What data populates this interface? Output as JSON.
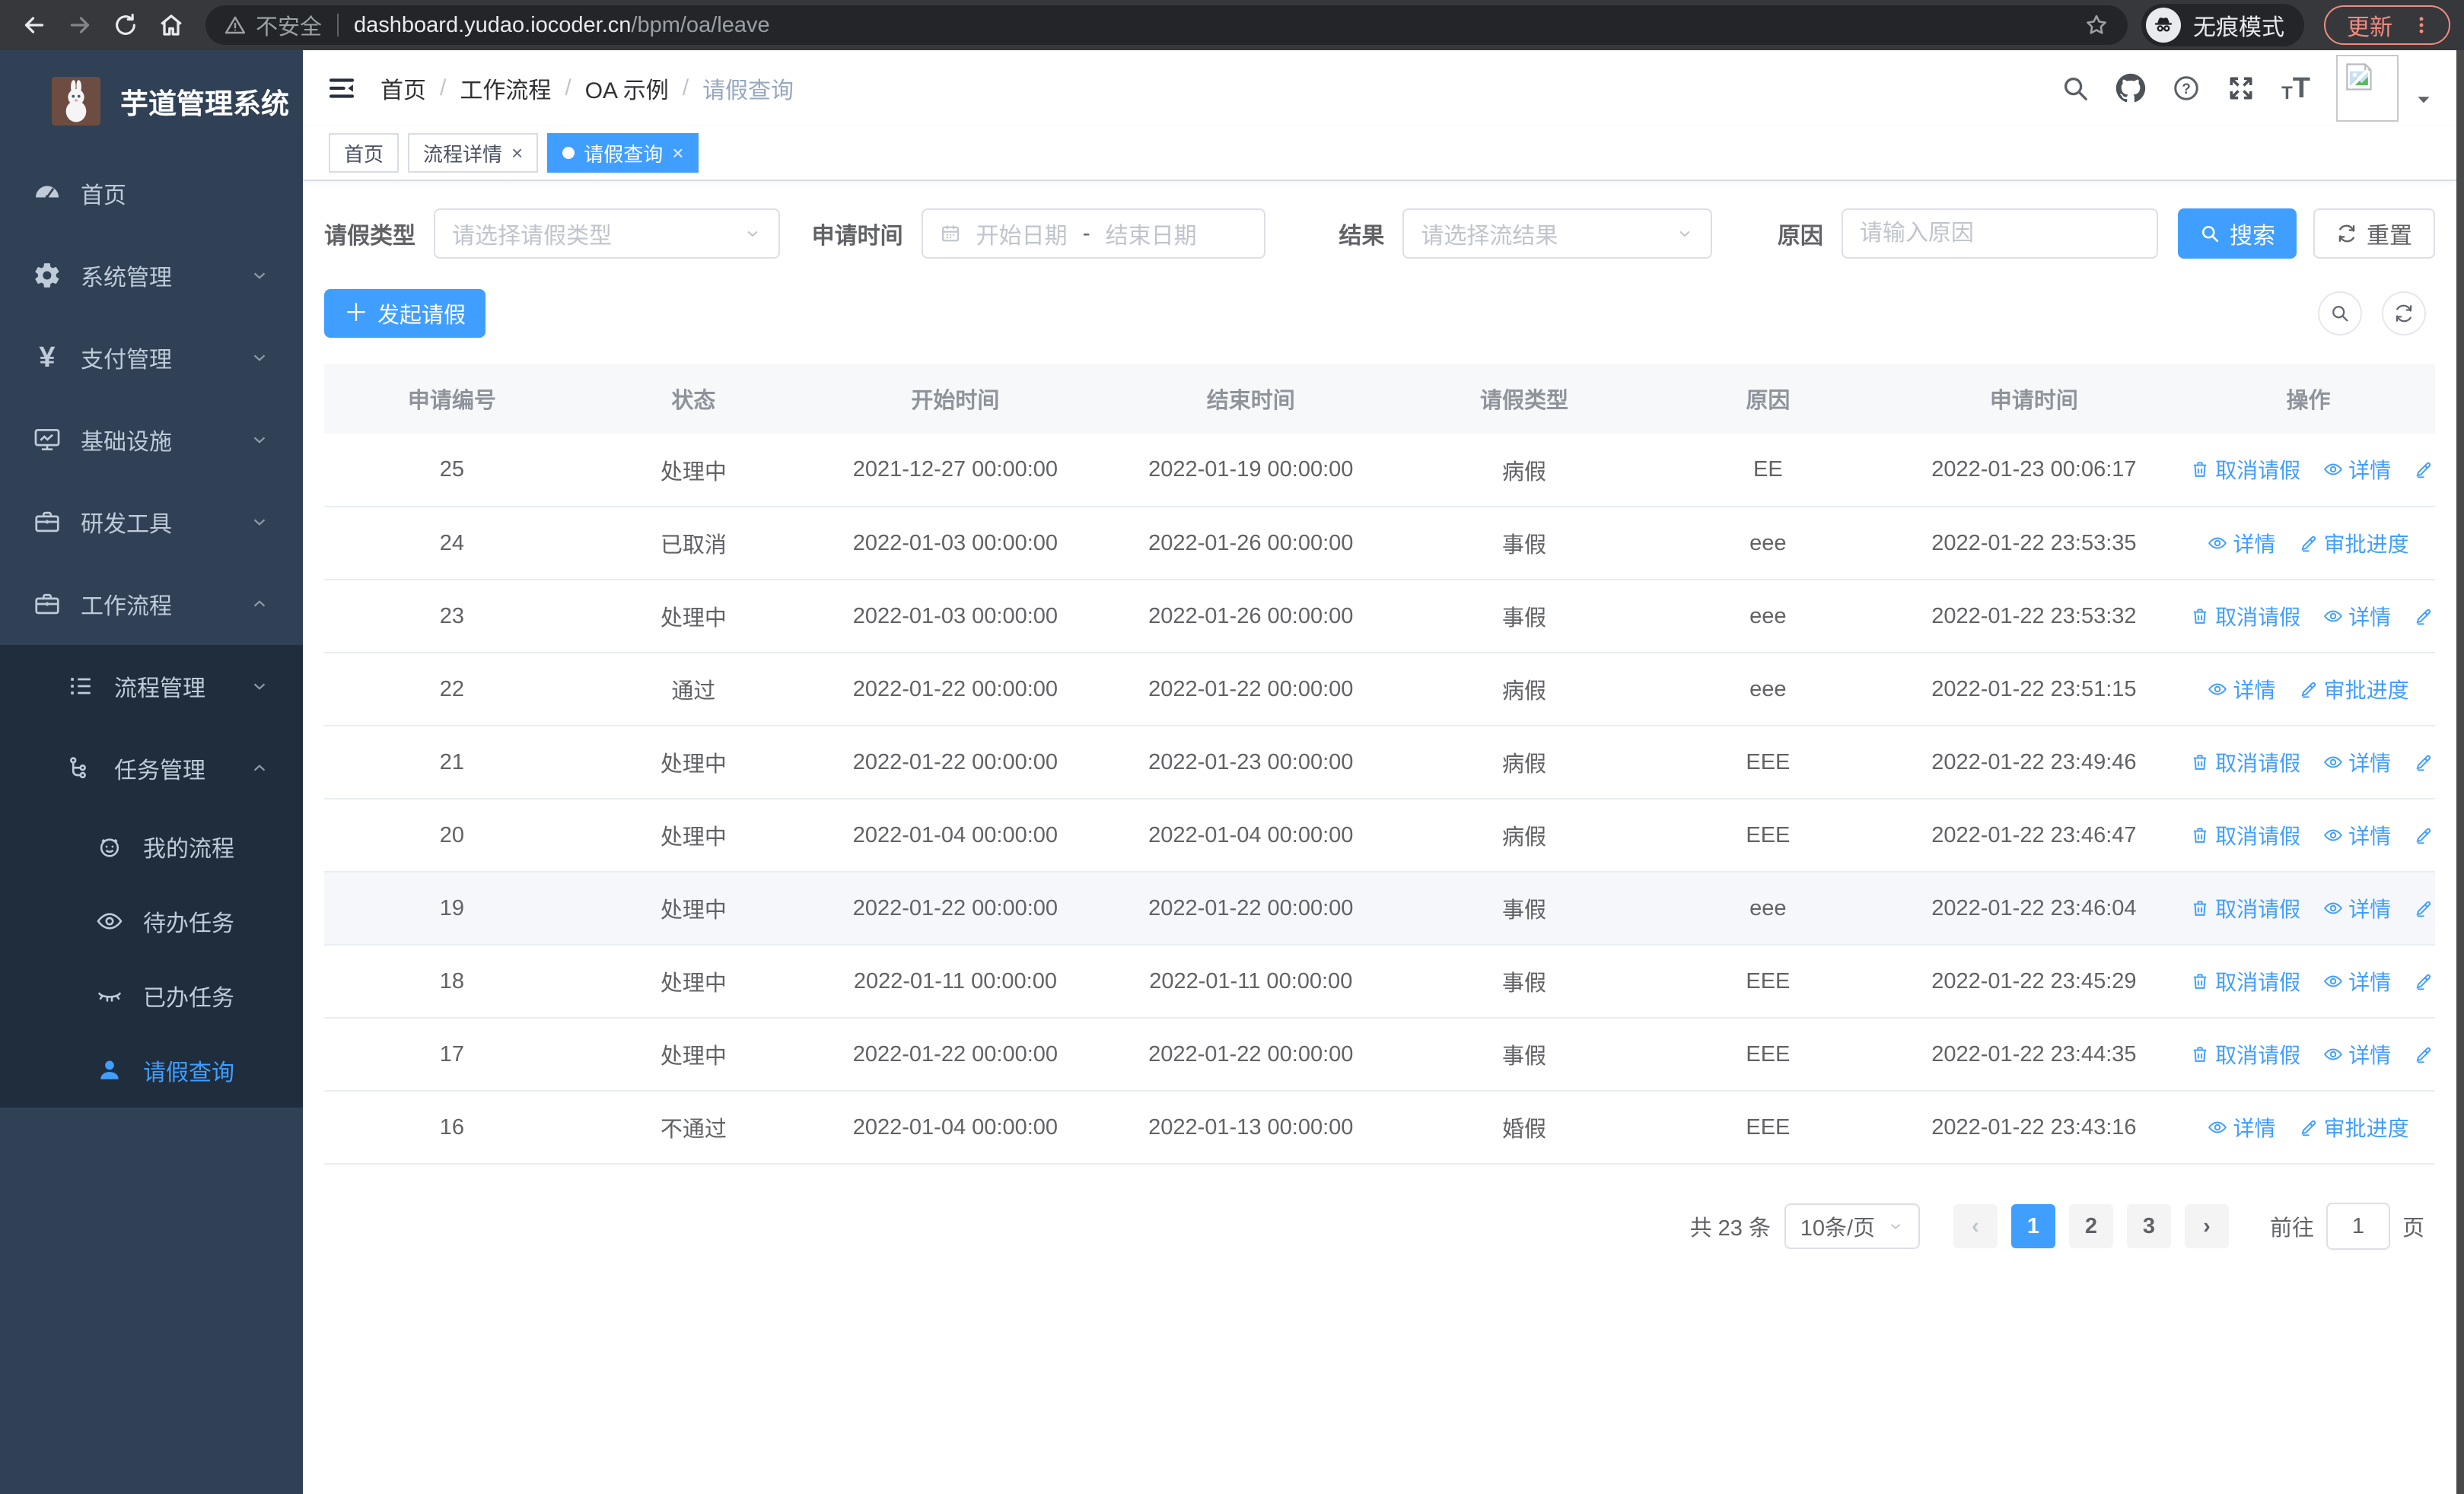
{
  "browser": {
    "security_label": "不安全",
    "url_host": "dashboard.yudao.iocoder.cn",
    "url_path": "/bpm/oa/leave",
    "incognito_label": "无痕模式",
    "update_label": "更新"
  },
  "sidebar": {
    "title": "芋道管理系统",
    "items": [
      "首页",
      "系统管理",
      "支付管理",
      "基础设施",
      "研发工具",
      "工作流程",
      "流程管理",
      "任务管理",
      "我的流程",
      "待办任务",
      "已办任务",
      "请假查询"
    ]
  },
  "breadcrumb": {
    "items": [
      "首页",
      "工作流程",
      "OA 示例",
      "请假查询"
    ]
  },
  "tabs": [
    {
      "label": "首页",
      "closable": false,
      "active": false
    },
    {
      "label": "流程详情",
      "closable": true,
      "active": false
    },
    {
      "label": "请假查询",
      "closable": true,
      "active": true
    }
  ],
  "header_icons": [
    "search-icon",
    "github-icon",
    "help-icon",
    "fullscreen-icon",
    "font-size-icon",
    "avatar",
    "dropdown-caret"
  ],
  "filters": {
    "leave_type_label": "请假类型",
    "leave_type_placeholder": "请选择请假类型",
    "apply_time_label": "申请时间",
    "start_date_placeholder": "开始日期",
    "end_date_placeholder": "结束日期",
    "result_label": "结果",
    "result_placeholder": "请选择流结果",
    "reason_label": "原因",
    "reason_placeholder": "请输入原因",
    "search_label": "搜索",
    "reset_label": "重置"
  },
  "toolbar": {
    "create_label": "发起请假"
  },
  "table": {
    "headers": [
      "申请编号",
      "状态",
      "开始时间",
      "结束时间",
      "请假类型",
      "原因",
      "申请时间",
      "操作"
    ],
    "action_labels": {
      "cancel": "取消请假",
      "detail": "详情",
      "progress": "审批进度"
    },
    "rows": [
      {
        "id": "25",
        "status": "处理中",
        "start": "2021-12-27 00:00:00",
        "end": "2022-01-19 00:00:00",
        "type": "病假",
        "reason": "EE",
        "applied": "2022-01-23 00:06:17",
        "cancellable": true,
        "highlighted": false
      },
      {
        "id": "24",
        "status": "已取消",
        "start": "2022-01-03 00:00:00",
        "end": "2022-01-26 00:00:00",
        "type": "事假",
        "reason": "eee",
        "applied": "2022-01-22 23:53:35",
        "cancellable": false,
        "highlighted": false
      },
      {
        "id": "23",
        "status": "处理中",
        "start": "2022-01-03 00:00:00",
        "end": "2022-01-26 00:00:00",
        "type": "事假",
        "reason": "eee",
        "applied": "2022-01-22 23:53:32",
        "cancellable": true,
        "highlighted": false
      },
      {
        "id": "22",
        "status": "通过",
        "start": "2022-01-22 00:00:00",
        "end": "2022-01-22 00:00:00",
        "type": "病假",
        "reason": "eee",
        "applied": "2022-01-22 23:51:15",
        "cancellable": false,
        "highlighted": false
      },
      {
        "id": "21",
        "status": "处理中",
        "start": "2022-01-22 00:00:00",
        "end": "2022-01-23 00:00:00",
        "type": "病假",
        "reason": "EEE",
        "applied": "2022-01-22 23:49:46",
        "cancellable": true,
        "highlighted": false
      },
      {
        "id": "20",
        "status": "处理中",
        "start": "2022-01-04 00:00:00",
        "end": "2022-01-04 00:00:00",
        "type": "病假",
        "reason": "EEE",
        "applied": "2022-01-22 23:46:47",
        "cancellable": true,
        "highlighted": false
      },
      {
        "id": "19",
        "status": "处理中",
        "start": "2022-01-22 00:00:00",
        "end": "2022-01-22 00:00:00",
        "type": "事假",
        "reason": "eee",
        "applied": "2022-01-22 23:46:04",
        "cancellable": true,
        "highlighted": true
      },
      {
        "id": "18",
        "status": "处理中",
        "start": "2022-01-11 00:00:00",
        "end": "2022-01-11 00:00:00",
        "type": "事假",
        "reason": "EEE",
        "applied": "2022-01-22 23:45:29",
        "cancellable": true,
        "highlighted": false
      },
      {
        "id": "17",
        "status": "处理中",
        "start": "2022-01-22 00:00:00",
        "end": "2022-01-22 00:00:00",
        "type": "事假",
        "reason": "EEE",
        "applied": "2022-01-22 23:44:35",
        "cancellable": true,
        "highlighted": false
      },
      {
        "id": "16",
        "status": "不通过",
        "start": "2022-01-04 00:00:00",
        "end": "2022-01-13 00:00:00",
        "type": "婚假",
        "reason": "EEE",
        "applied": "2022-01-22 23:43:16",
        "cancellable": false,
        "highlighted": false
      }
    ]
  },
  "pagination": {
    "total": "共 23 条",
    "page_size": "10条/页",
    "pages": [
      "1",
      "2",
      "3"
    ],
    "active_page": "1",
    "goto_label": "前往",
    "goto_value": "1",
    "page_unit": "页"
  },
  "glyphs": {
    "slash": "/",
    "dash": "-",
    "close": "×",
    "plus": "＋",
    "yen": "¥",
    "t": "T",
    "question": "?",
    "prev": "‹",
    "next": "›"
  },
  "colors": {
    "accent": "#409eff",
    "sidebar_bg": "#304156",
    "submenu_bg": "#1f2d3d",
    "chrome_bg": "#37383b",
    "update_pink": "#f28b82",
    "row_highlight": "#f5f7fa"
  }
}
